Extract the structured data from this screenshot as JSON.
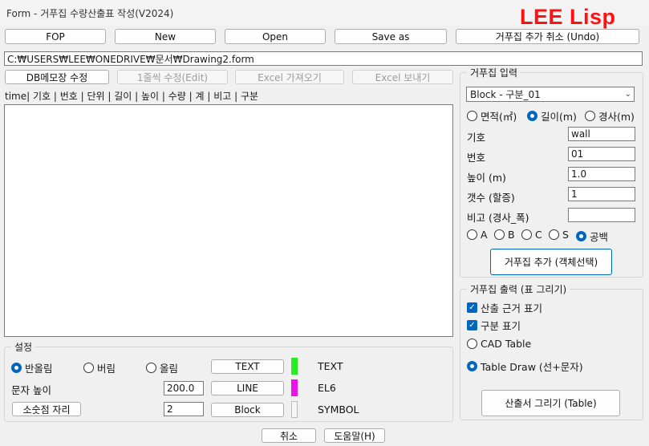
{
  "window": {
    "title": "Form - 거푸집 수량산출표 작성(V2024)",
    "brand": "LEE Lisp",
    "minimize_glyph": "—",
    "maximize_glyph": "☐",
    "close_glyph": "✕"
  },
  "toolbar": {
    "fop": "FOP",
    "new": "New",
    "open": "Open",
    "save_as": "Save as",
    "undo": "거푸집 추가 취소 (Undo)"
  },
  "path": "C:₩USERS₩LEE₩ONEDRIVE₩문서₩Drawing2.form",
  "actions": {
    "db_memo": "DB메모장 수정",
    "edit_row": "1줄씩 수정(Edit)",
    "excel_import": "Excel 가져오기",
    "excel_export": "Excel 보내기"
  },
  "list_header": "time| 기호 | 번호 | 단위 |      길이      |       높이       |        수량        |       계       |    비고    | 구분",
  "input_panel": {
    "title": "거푸집 입력",
    "block_select": "Block - 구분_01",
    "mode_options": [
      "면적(㎡)",
      "길이(m)",
      "경사(m)"
    ],
    "mode_selected": 1,
    "fields": [
      {
        "label": "기호",
        "value": "wall"
      },
      {
        "label": "번호",
        "value": "01"
      },
      {
        "label": "높이 (m)",
        "value": "1.0"
      },
      {
        "label": "갯수 (할증)",
        "value": "1"
      },
      {
        "label": "비고 (경사_폭)",
        "value": ""
      }
    ],
    "category_options": [
      "A",
      "B",
      "C",
      "S",
      "공백"
    ],
    "category_selected": 4,
    "add_button": "거푸집 추가 (객체선택)"
  },
  "output_panel": {
    "title": "거푸집 출력 (표 그리기)",
    "checks": [
      "산출 근거 표기",
      "구분 표기"
    ],
    "table_options": [
      "CAD Table",
      "Table Draw (선+문자)"
    ],
    "table_selected": 1,
    "draw_button": "산출서 그리기 (Table)"
  },
  "settings": {
    "title": "설정",
    "rounding": [
      "반올림",
      "버림",
      "올림"
    ],
    "rounding_selected": 0,
    "text_height_label": "문자 높이",
    "text_height_value": "200.0",
    "decimal_button": "소숫점 자리",
    "decimal_value": "2",
    "layers": [
      {
        "button": "TEXT",
        "color": "#22ee22",
        "name": "TEXT"
      },
      {
        "button": "LINE",
        "color": "#ee11ee",
        "name": "EL6"
      },
      {
        "button": "Block",
        "color": "#f7f7f7",
        "name": "SYMBOL"
      }
    ]
  },
  "footer": {
    "cancel": "취소",
    "help": "도움말(H)"
  }
}
